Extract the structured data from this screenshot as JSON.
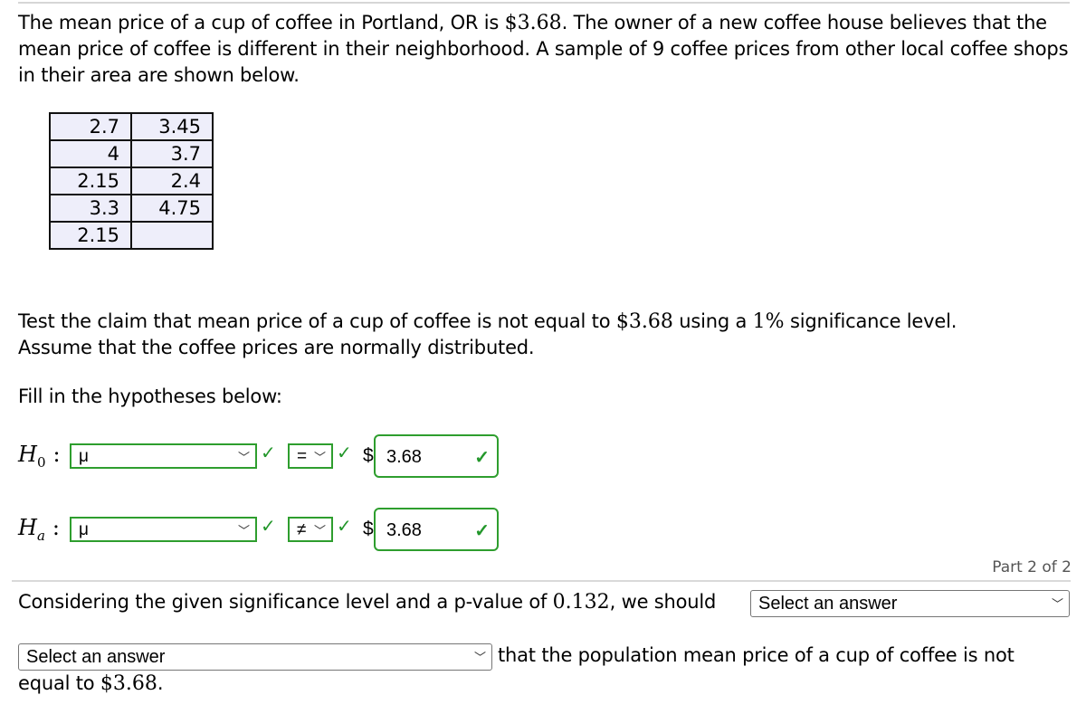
{
  "problem": {
    "intro_part1": "The mean price of a cup of coffee in Portland, OR is ",
    "intro_mean": "$3.68",
    "intro_part2": ". The owner of a new coffee house believes that the mean price of coffee is different in their neighborhood. A sample of 9 coffee prices from other local coffee shops in their area are shown below.",
    "sample_table": [
      [
        "2.7",
        "3.45"
      ],
      [
        "4",
        "3.7"
      ],
      [
        "2.15",
        "2.4"
      ],
      [
        "3.3",
        "4.75"
      ],
      [
        "2.15",
        ""
      ]
    ],
    "claim_part1": "Test the claim that mean price of a cup of coffee is not equal to ",
    "claim_value": "$3.68",
    "claim_part2": " using a ",
    "claim_alpha": "1%",
    "claim_part3": " significance level.",
    "claim_line2": "Assume that the coffee prices are normally distributed.",
    "fill_prompt": "Fill in the hypotheses below:"
  },
  "hypotheses": {
    "h0": {
      "label_main": "H",
      "label_sub": "0",
      "colon": ":",
      "parameter": "μ",
      "operator": "=",
      "currency": "$",
      "value": "3.68",
      "status": "correct"
    },
    "ha": {
      "label_main": "H",
      "label_sub": "a",
      "colon": ":",
      "parameter": "μ",
      "operator": "≠",
      "currency": "$",
      "value": "3.68",
      "status": "correct"
    }
  },
  "part_indicator": "Part 2 of 2",
  "part2": {
    "sentence1_part1": "Considering the given significance level and a p-value of ",
    "p_value": "0.132",
    "sentence1_part2": ", we should",
    "select1_value": "Select an answer",
    "select2_value": "Select an answer",
    "sentence2_part1": "that the population mean price of a cup of coffee is not",
    "sentence2_part2": "equal to ",
    "sentence2_value": "$3.68",
    "sentence2_end": "."
  },
  "icons": {
    "check": "✓",
    "chevron_down": "﹀"
  },
  "colors": {
    "correct_green": "#2e9e2e",
    "table_bg": "#eeeefa"
  }
}
